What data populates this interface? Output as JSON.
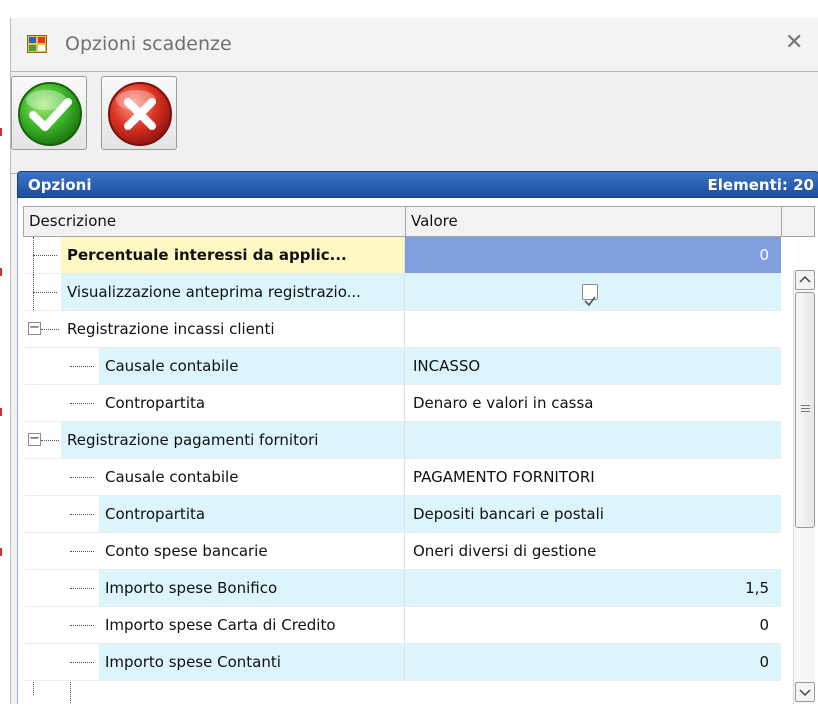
{
  "window": {
    "title": "Opzioni scadenze",
    "close_glyph": "✕"
  },
  "toolbar": {
    "confirm_icon": "green-check-icon",
    "cancel_icon": "red-x-icon"
  },
  "panel": {
    "title": "Opzioni",
    "count_label": "Elementi: 20"
  },
  "grid": {
    "columns": [
      "Descrizione",
      "Valore"
    ],
    "rows": [
      {
        "label": "Percentuale interessi da applic...",
        "value": "0",
        "level": 0,
        "selected": true
      },
      {
        "label": "Visualizzazione anteprima registrazio...",
        "value": "",
        "checked": true,
        "level": 0
      },
      {
        "label": "Registrazione incassi clienti",
        "value": "",
        "level": 0,
        "expanded": true
      },
      {
        "label": "Causale contabile",
        "value": "INCASSO",
        "level": 1
      },
      {
        "label": "Contropartita",
        "value": "Denaro e valori in cassa",
        "level": 1,
        "last": true
      },
      {
        "label": "Registrazione pagamenti fornitori",
        "value": "",
        "level": 0,
        "expanded": true
      },
      {
        "label": "Causale contabile",
        "value": "PAGAMENTO FORNITORI",
        "level": 1
      },
      {
        "label": "Contropartita",
        "value": "Depositi bancari e postali",
        "level": 1
      },
      {
        "label": "Conto spese bancarie",
        "value": "Oneri diversi di gestione",
        "level": 1
      },
      {
        "label": "Importo spese Bonifico",
        "value": "1,5",
        "level": 1
      },
      {
        "label": "Importo spese Carta di Credito",
        "value": "0",
        "level": 1
      },
      {
        "label": "Importo spese Contanti",
        "value": "0",
        "level": 1
      }
    ]
  },
  "colors": {
    "header_blue": "#1c4ea2",
    "row_alt": "#dcf4fb",
    "selected_value": "#7f9fde",
    "selected_label": "#fff8c2"
  }
}
